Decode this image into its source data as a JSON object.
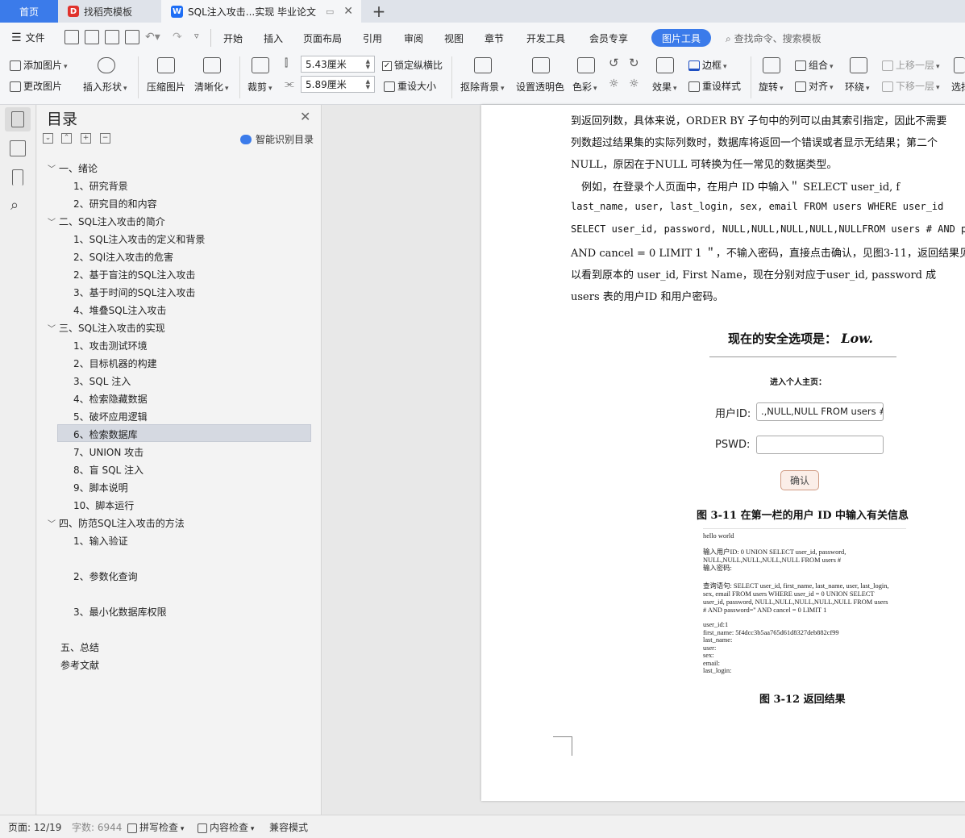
{
  "tabs": {
    "home": "首页",
    "templates": "找稻壳模板",
    "document": "SQL注入攻击...实现 毕业论文"
  },
  "menu": {
    "file": "文件",
    "items": [
      "开始",
      "插入",
      "页面布局",
      "引用",
      "审阅",
      "视图",
      "章节",
      "开发工具",
      "会员专享"
    ],
    "active": "图片工具",
    "search": "查找命令、搜索模板"
  },
  "ribbon": {
    "add_picture": "添加图片",
    "change_picture": "更改图片",
    "insert_shape": "插入形状",
    "compress": "压缩图片",
    "sharpen": "清晰化",
    "crop": "裁剪",
    "height": "5.43厘米",
    "width": "5.89厘米",
    "lock_ratio": "锁定纵横比",
    "reset_size": "重设大小",
    "remove_bg": "抠除背景",
    "transparency": "设置透明色",
    "color": "色彩",
    "effects": "效果",
    "border": "边框",
    "reset_style": "重设样式",
    "rotate": "旋转",
    "group": "组合",
    "align": "对齐",
    "wrap": "环绕",
    "bring_forward": "上移一层",
    "send_backward": "下移一层",
    "select": "选择"
  },
  "toc": {
    "title": "目录",
    "smart": "智能识别目录",
    "items": [
      {
        "text": "一、绪论"
      },
      {
        "text": "1、研究背景"
      },
      {
        "text": "2、研究目的和内容"
      },
      {
        "text": "二、SQL注入攻击的简介"
      },
      {
        "text": "1、SQL注入攻击的定义和背景"
      },
      {
        "text": "2、SQl注入攻击的危害"
      },
      {
        "text": "2、基于盲注的SQL注入攻击"
      },
      {
        "text": "3、基于时间的SQL注入攻击"
      },
      {
        "text": "4、堆叠SQL注入攻击"
      },
      {
        "text": "三、SQL注入攻击的实现"
      },
      {
        "text": "1、攻击测试环境"
      },
      {
        "text": "2、目标机器的构建"
      },
      {
        "text": "3、SQL 注入"
      },
      {
        "text": "4、检索隐藏数据"
      },
      {
        "text": "5、破坏应用逻辑"
      },
      {
        "text": "6、检索数据库"
      },
      {
        "text": "7、UNION 攻击"
      },
      {
        "text": "8、盲 SQL 注入"
      },
      {
        "text": "9、脚本说明"
      },
      {
        "text": "10、脚本运行"
      },
      {
        "text": "四、防范SQL注入攻击的方法"
      },
      {
        "text": "1、输入验证"
      },
      {
        "text": "2、参数化查询"
      },
      {
        "text": "3、最小化数据库权限"
      },
      {
        "text": "五、总结"
      },
      {
        "text": "参考文献"
      }
    ]
  },
  "document": {
    "lines": [
      "到返回列数，具体来说，ORDER BY 子句中的列可以由其索引指定，因此不需要",
      "列数超过结果集的实际列数时，数据库将返回一个错误或者显示无结果；第二个",
      "NULL，原因在于NULL 可转换为任一常见的数据类型。",
      "　例如，在登录个人页面中，在用户 ID 中输入＂ SELECT user_id, f",
      "last_name,  user,  last_login,  sex,  email  FROM  users  WHERE  user_id",
      "SELECT user_id, password,  NULL,NULL,NULL,NULL,NULLFROM users # AND p",
      "AND cancel = 0 LIMIT 1 ＂，不输入密码，直接点击确认，见图3-11，返回结果见",
      "以看到原本的 user_id, First Name，现在分别对应于user_id, password 成",
      "users 表的用户ID 和用户密码。"
    ],
    "figure": {
      "security_prefix": "现在的安全选项是：",
      "security_level": "Low.",
      "subtitle": "进入个人主页：",
      "user_label": "用户ID:",
      "user_value": ".,NULL,NULL FROM users #",
      "pswd_label": "PSWD:",
      "confirm": "确认"
    },
    "caption_311": "图 3-11  在第一栏的用户 ID 中输入有关信息",
    "result_lines": [
      "hello world",
      "",
      "输入用户ID: 0 UNION SELECT user_id, password,",
      "NULL,NULL,NULL,NULL,NULL FROM users #",
      "输入密码:",
      "",
      "查询语句: SELECT user_id, first_name, last_name, user, last_login,",
      "sex, email FROM users WHERE user_id = 0 UNION SELECT",
      "user_id, password, NULL,NULL,NULL,NULL,NULL FROM users",
      "# AND password='' AND cancel = 0 LIMIT 1",
      "",
      "user_id:1",
      "first_name: 5f4dcc3b5aa765d61d8327deb882cf99",
      "last_name:",
      "user:",
      "sex:",
      "email:",
      "last_login:"
    ],
    "caption_312": "图 3-12  返回结果"
  },
  "status": {
    "page": "页面: 12/19",
    "words": "字数: 6944",
    "spell": "拼写检查",
    "content": "内容检查",
    "compat": "兼容模式"
  }
}
